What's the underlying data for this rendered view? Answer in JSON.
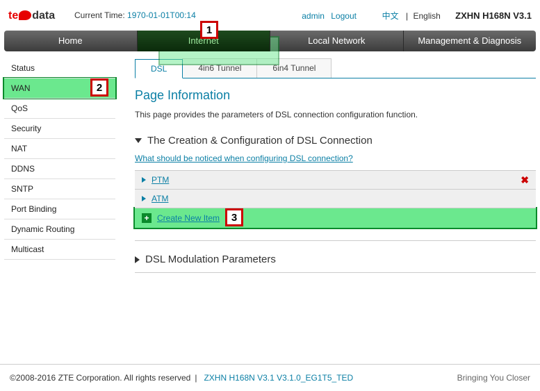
{
  "header": {
    "logo_prefix": "te",
    "logo_suffix": "data",
    "time_label": "Current Time:",
    "time_value": "1970-01-01T00:14",
    "user": "admin",
    "logout": "Logout",
    "lang_cn": "中文",
    "lang_sep": "|",
    "lang_en": "English",
    "model": "ZXHN H168N V3.1"
  },
  "nav": {
    "items": [
      "Home",
      "Internet",
      "Local Network",
      "Management & Diagnosis"
    ],
    "active_index": 1
  },
  "sidebar": {
    "items": [
      "Status",
      "WAN",
      "QoS",
      "Security",
      "NAT",
      "DDNS",
      "SNTP",
      "Port Binding",
      "Dynamic Routing",
      "Multicast"
    ],
    "active_index": 1
  },
  "tabs": {
    "items": [
      "DSL",
      "4in6 Tunnel",
      "6in4 Tunnel"
    ],
    "active_index": 0
  },
  "page": {
    "title": "Page Information",
    "description": "This page provides the parameters of DSL connection configuration function."
  },
  "section1": {
    "title": "The Creation & Configuration of DSL Connection",
    "help_link": "What should be noticed when configuring DSL connection?",
    "rows": [
      "PTM",
      "ATM"
    ],
    "create_label": "Create New Item"
  },
  "section2": {
    "title": "DSL Modulation Parameters"
  },
  "footer": {
    "copyright": "©2008-2016 ZTE Corporation. All rights reserved",
    "sep": "|",
    "fw": "ZXHN H168N V3.1 V3.1.0_EG1T5_TED",
    "tagline": "Bringing You Closer"
  },
  "markers": {
    "m1": "1",
    "m2": "2",
    "m3": "3"
  }
}
